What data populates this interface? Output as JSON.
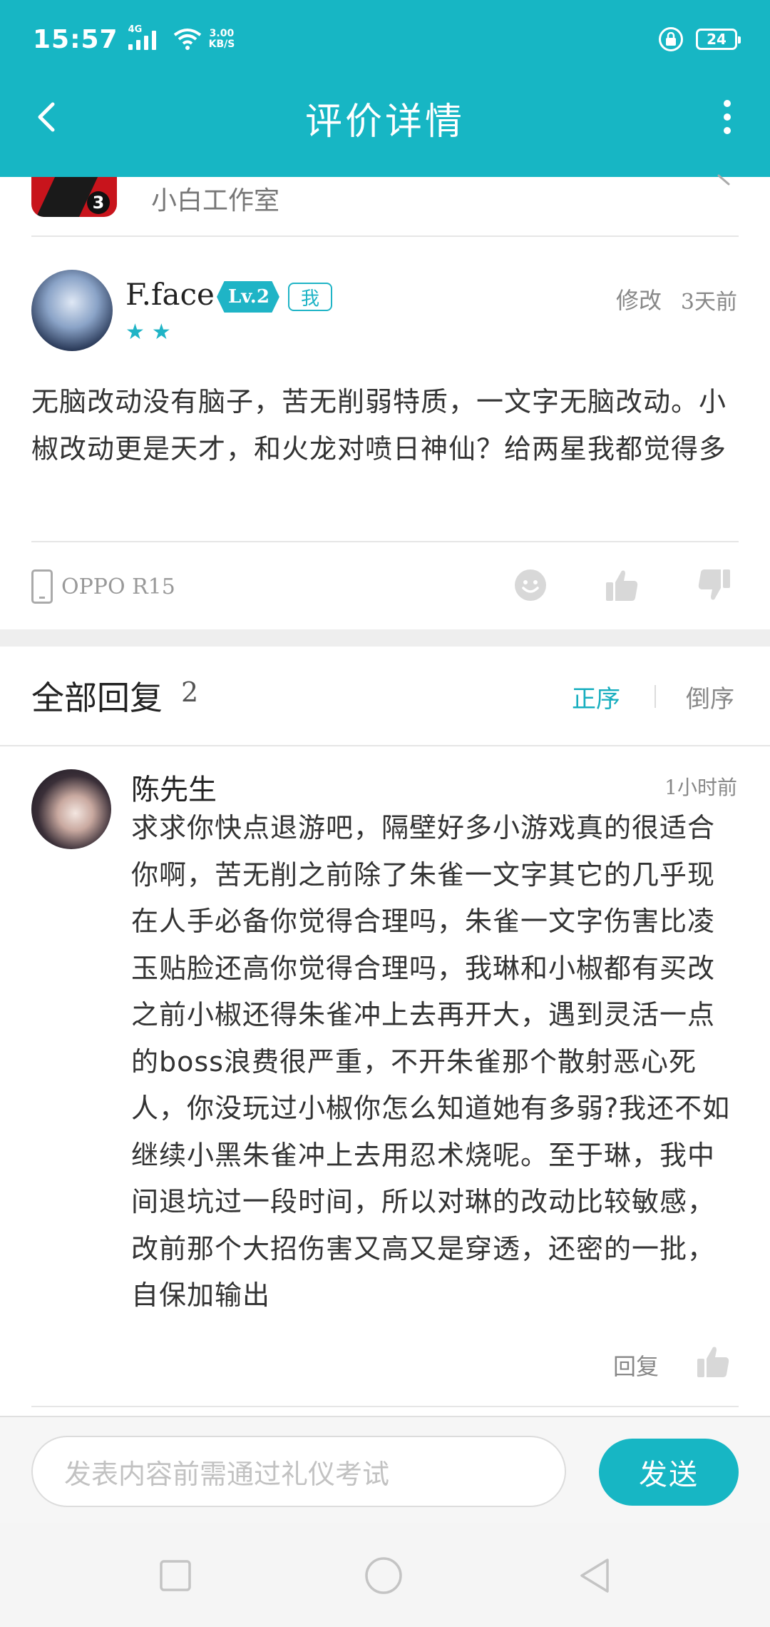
{
  "status_bar": {
    "time": "15:57",
    "network": "4G",
    "speed_value": "3.00",
    "speed_unit": "KB/S",
    "battery": "24"
  },
  "app_bar": {
    "title": "评价详情",
    "back_icon": "chevron-left-icon",
    "more_icon": "more-vertical-icon"
  },
  "app_info": {
    "developer": "小白工作室",
    "icon_badge": "3"
  },
  "review": {
    "username": "F.face",
    "level": "Lv.2",
    "me_tag": "我",
    "stars": 2,
    "edit_label": "修改",
    "time_ago": "3天前",
    "content": "无脑改动没有脑子，苦无削弱特质，一文字无脑改动。小椒改动更是天才，和火龙对喷日神仙？给两星我都觉得多",
    "device": "OPPO R15"
  },
  "replies": {
    "title": "全部回复",
    "count": "2",
    "sort_asc": "正序",
    "sort_desc": "倒序",
    "items": [
      {
        "username": "陈先生",
        "time_ago": "1小时前",
        "content": "求求你快点退游吧，隔壁好多小游戏真的很适合你啊，苦无削之前除了朱雀一文字其它的几乎现在人手必备你觉得合理吗，朱雀一文字伤害比凌玉贴脸还高你觉得合理吗，我琳和小椒都有买改之前小椒还得朱雀冲上去再开大，遇到灵活一点的boss浪费很严重，不开朱雀那个散射恶心死人，你没玩过小椒你怎么知道她有多弱?我还不如继续小黑朱雀冲上去用忍术烧呢。至于琳，我中间退坑过一段时间，所以对琳的改动比较敏感，改前那个大招伤害又高又是穿透，还密的一批，自保加输出",
        "reply_label": "回复"
      }
    ]
  },
  "input_bar": {
    "placeholder": "发表内容前需通过礼仪考试",
    "send_label": "发送"
  },
  "colors": {
    "brand": "#17b6c4",
    "text_primary": "#222222",
    "text_secondary": "#888888"
  }
}
